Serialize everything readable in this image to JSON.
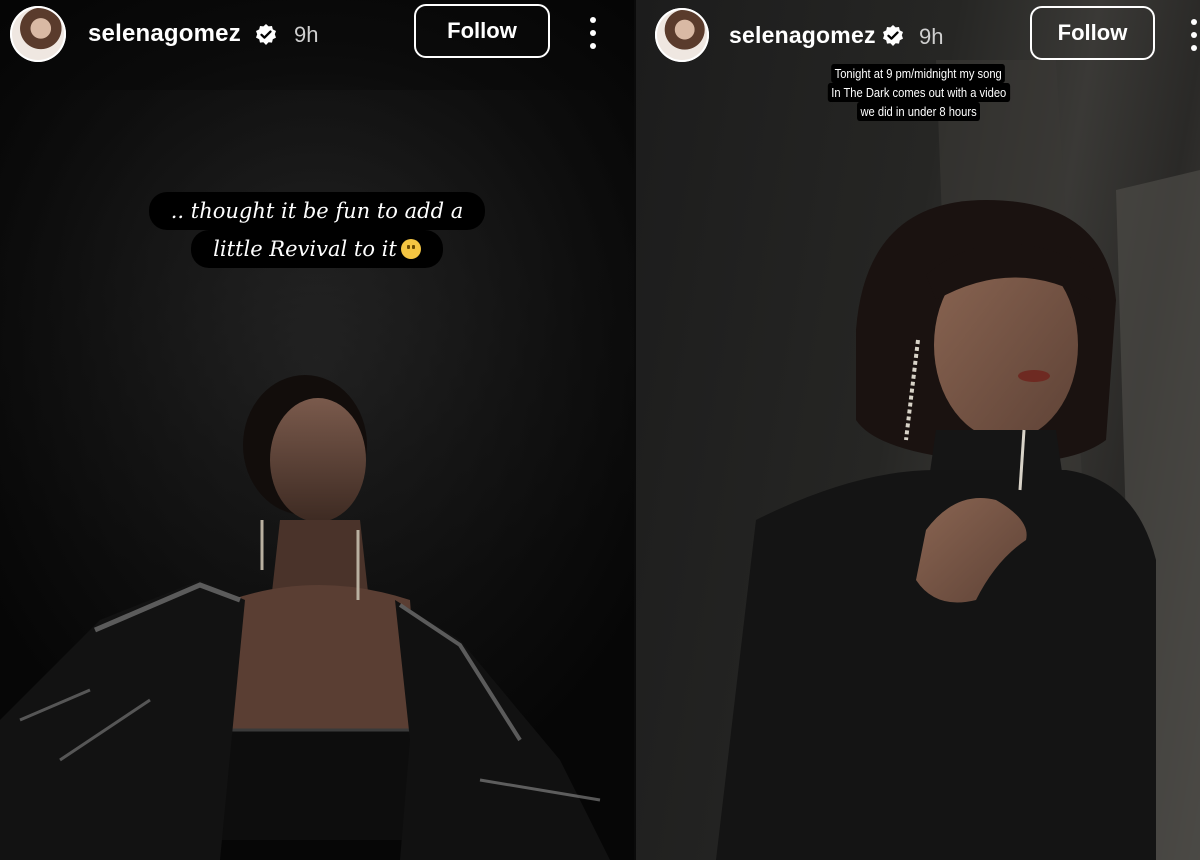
{
  "stories": [
    {
      "username": "selenagomez",
      "time": "9h",
      "follow_label": "Follow",
      "caption_lines": [
        ".. thought it be fun to add a",
        "little Revival to it"
      ]
    },
    {
      "username": "selenagomez",
      "time": "9h",
      "follow_label": "Follow",
      "caption_lines": [
        "Tonight at 9 pm/midnight my song",
        "In The Dark comes out with a video",
        "we did in under 8 hours"
      ]
    }
  ],
  "icons": {
    "verified": "verified-badge-icon",
    "more": "more-options-icon",
    "emoji": "slightly-smiling-face-emoji"
  },
  "colors": {
    "text": "#ffffff",
    "verified_badge": "#ffffff",
    "background": "#000000"
  }
}
